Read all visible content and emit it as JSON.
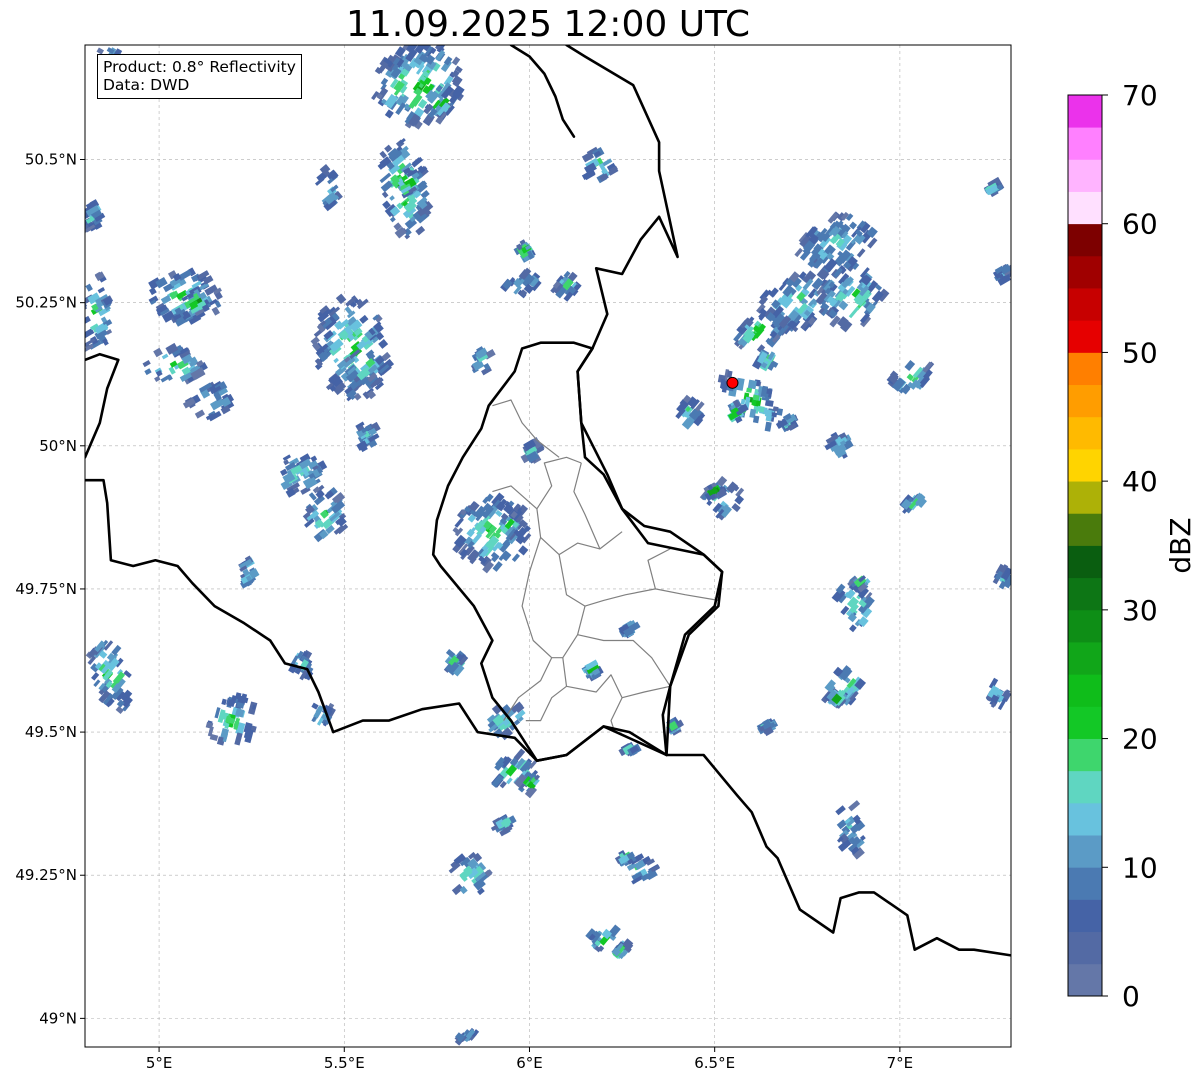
{
  "title": "11.09.2025 12:00 UTC",
  "info": {
    "product": "Product: 0.8° Reflectivity",
    "source": "Data: DWD"
  },
  "axes": {
    "lon_ticks": [
      "5°E",
      "5.5°E",
      "6°E",
      "6.5°E",
      "7°E"
    ],
    "lat_ticks": [
      "50.5°N",
      "50.25°N",
      "50°N",
      "49.75°N",
      "49.5°N",
      "49.25°N",
      "49°N"
    ],
    "lon_values": [
      5.0,
      5.5,
      6.0,
      6.5,
      7.0
    ],
    "lat_values": [
      50.5,
      50.25,
      50.0,
      49.75,
      49.5,
      49.25,
      49.0
    ],
    "lon_range": [
      4.8,
      7.3
    ],
    "lat_range": [
      48.95,
      50.7
    ],
    "grid": true
  },
  "colorbar": {
    "unit": "dBZ",
    "tick_labels": [
      "0",
      "10",
      "20",
      "30",
      "40",
      "50",
      "60",
      "70"
    ],
    "range": [
      0,
      70
    ],
    "step": 2.5,
    "colors": [
      "#6477a8",
      "#536aa4",
      "#4563a6",
      "#4b7ab2",
      "#5b9bc6",
      "#68c2de",
      "#5fd6c1",
      "#3ed66d",
      "#13c826",
      "#0fbd1a",
      "#11a619",
      "#0e8e16",
      "#0d7615",
      "#0a5e10",
      "#4a7b0c",
      "#adb107",
      "#ffd400",
      "#ffba00",
      "#ff9d00",
      "#ff7f00",
      "#e60000",
      "#c70000",
      "#a00000",
      "#7d0000",
      "#ffe0ff",
      "#ffb4ff",
      "#ff80ff",
      "#eb32eb"
    ]
  },
  "radar_site": {
    "lon": 6.548,
    "lat": 50.11,
    "color": "#ff0000"
  },
  "borders": {
    "country": [
      [
        [
          4.8,
          50.15
        ],
        [
          4.84,
          50.16
        ],
        [
          4.89,
          50.15
        ],
        [
          4.86,
          50.1
        ],
        [
          4.84,
          50.04
        ],
        [
          4.8,
          49.98
        ]
      ],
      [
        [
          4.8,
          49.94
        ],
        [
          4.85,
          49.94
        ],
        [
          4.86,
          49.9
        ],
        [
          4.87,
          49.8
        ],
        [
          4.93,
          49.79
        ],
        [
          4.99,
          49.8
        ],
        [
          5.05,
          49.79
        ],
        [
          5.09,
          49.76
        ],
        [
          5.15,
          49.72
        ],
        [
          5.23,
          49.69
        ],
        [
          5.3,
          49.66
        ],
        [
          5.34,
          49.62
        ],
        [
          5.4,
          49.61
        ],
        [
          5.43,
          49.57
        ],
        [
          5.47,
          49.5
        ],
        [
          5.55,
          49.52
        ],
        [
          5.62,
          49.52
        ],
        [
          5.71,
          49.54
        ],
        [
          5.81,
          49.55
        ],
        [
          5.86,
          49.5
        ],
        [
          5.96,
          49.49
        ],
        [
          6.02,
          49.45
        ],
        [
          6.1,
          49.46
        ],
        [
          6.2,
          49.51
        ],
        [
          6.27,
          49.5
        ],
        [
          6.37,
          49.46
        ],
        [
          6.47,
          49.46
        ],
        [
          6.56,
          49.39
        ],
        [
          6.6,
          49.36
        ],
        [
          6.64,
          49.3
        ],
        [
          6.67,
          49.28
        ],
        [
          6.73,
          49.19
        ],
        [
          6.82,
          49.15
        ],
        [
          6.84,
          49.21
        ],
        [
          6.89,
          49.22
        ],
        [
          6.93,
          49.22
        ],
        [
          7.02,
          49.18
        ],
        [
          7.04,
          49.12
        ],
        [
          7.1,
          49.14
        ],
        [
          7.16,
          49.12
        ],
        [
          7.2,
          49.12
        ],
        [
          7.3,
          49.11
        ]
      ],
      [
        [
          6.13,
          50.13
        ],
        [
          6.17,
          50.17
        ],
        [
          6.12,
          50.18
        ],
        [
          6.03,
          50.18
        ],
        [
          5.98,
          50.17
        ],
        [
          5.96,
          50.13
        ],
        [
          5.89,
          50.07
        ],
        [
          5.87,
          50.03
        ],
        [
          5.82,
          49.98
        ],
        [
          5.78,
          49.93
        ],
        [
          5.75,
          49.87
        ],
        [
          5.74,
          49.81
        ],
        [
          5.76,
          49.79
        ],
        [
          5.85,
          49.72
        ],
        [
          5.9,
          49.66
        ],
        [
          5.87,
          49.62
        ],
        [
          5.9,
          49.56
        ],
        [
          5.95,
          49.52
        ],
        [
          6.02,
          49.45
        ],
        [
          6.1,
          49.46
        ],
        [
          6.2,
          49.51
        ],
        [
          6.37,
          49.46
        ],
        [
          6.36,
          49.53
        ],
        [
          6.38,
          49.58
        ],
        [
          6.42,
          49.67
        ],
        [
          6.5,
          49.72
        ],
        [
          6.52,
          49.78
        ],
        [
          6.47,
          49.81
        ],
        [
          6.38,
          49.85
        ],
        [
          6.31,
          49.86
        ],
        [
          6.25,
          49.89
        ],
        [
          6.21,
          49.95
        ],
        [
          6.14,
          50.04
        ],
        [
          6.13,
          50.13
        ]
      ],
      [
        [
          6.17,
          50.17
        ],
        [
          6.13,
          50.13
        ],
        [
          6.14,
          50.04
        ],
        [
          6.15,
          49.98
        ],
        [
          6.2,
          49.95
        ],
        [
          6.25,
          49.89
        ],
        [
          6.32,
          49.83
        ],
        [
          6.47,
          49.81
        ],
        [
          6.52,
          49.78
        ],
        [
          6.51,
          49.72
        ],
        [
          6.43,
          49.67
        ],
        [
          6.38,
          49.58
        ],
        [
          6.37,
          49.46
        ]
      ],
      [
        [
          6.17,
          50.17
        ],
        [
          6.21,
          50.23
        ],
        [
          6.18,
          50.31
        ],
        [
          6.25,
          50.3
        ],
        [
          6.3,
          50.36
        ],
        [
          6.35,
          50.4
        ],
        [
          6.4,
          50.33
        ],
        [
          6.35,
          50.48
        ],
        [
          6.35,
          50.53
        ],
        [
          6.28,
          50.63
        ],
        [
          6.15,
          50.68
        ],
        [
          6.1,
          50.7
        ]
      ],
      [
        [
          5.95,
          50.7
        ],
        [
          6.0,
          50.68
        ],
        [
          6.04,
          50.65
        ],
        [
          6.07,
          50.61
        ],
        [
          6.09,
          50.57
        ],
        [
          6.12,
          50.54
        ]
      ]
    ],
    "cantons": [
      [
        [
          5.9,
          49.92
        ],
        [
          5.95,
          49.93
        ],
        [
          6.02,
          49.89
        ],
        [
          6.06,
          49.93
        ],
        [
          6.04,
          49.97
        ],
        [
          6.1,
          49.98
        ],
        [
          6.14,
          49.97
        ]
      ],
      [
        [
          6.02,
          49.89
        ],
        [
          6.03,
          49.84
        ],
        [
          6.08,
          49.81
        ],
        [
          6.13,
          49.83
        ],
        [
          6.19,
          49.82
        ],
        [
          6.25,
          49.85
        ]
      ],
      [
        [
          6.03,
          49.84
        ],
        [
          6.0,
          49.78
        ],
        [
          5.98,
          49.72
        ],
        [
          6.01,
          49.66
        ],
        [
          6.06,
          49.63
        ],
        [
          6.03,
          49.59
        ],
        [
          5.97,
          49.56
        ],
        [
          5.93,
          49.52
        ]
      ],
      [
        [
          6.08,
          49.81
        ],
        [
          6.1,
          49.74
        ],
        [
          6.15,
          49.72
        ],
        [
          6.2,
          49.73
        ],
        [
          6.26,
          49.74
        ],
        [
          6.34,
          49.75
        ],
        [
          6.42,
          49.74
        ],
        [
          6.51,
          49.73
        ]
      ],
      [
        [
          6.15,
          49.72
        ],
        [
          6.13,
          49.67
        ],
        [
          6.09,
          49.63
        ],
        [
          6.06,
          49.63
        ]
      ],
      [
        [
          6.13,
          49.67
        ],
        [
          6.2,
          49.66
        ],
        [
          6.28,
          49.66
        ],
        [
          6.33,
          49.63
        ],
        [
          6.38,
          49.58
        ]
      ],
      [
        [
          6.09,
          49.63
        ],
        [
          6.1,
          49.58
        ],
        [
          6.06,
          49.56
        ],
        [
          6.03,
          49.52
        ],
        [
          5.99,
          49.52
        ]
      ],
      [
        [
          6.1,
          49.58
        ],
        [
          6.18,
          49.57
        ],
        [
          6.22,
          49.6
        ],
        [
          6.25,
          49.56
        ],
        [
          6.22,
          49.52
        ],
        [
          6.23,
          49.5
        ]
      ],
      [
        [
          6.25,
          49.56
        ],
        [
          6.31,
          49.57
        ],
        [
          6.38,
          49.58
        ]
      ],
      [
        [
          6.34,
          49.75
        ],
        [
          6.32,
          49.8
        ],
        [
          6.38,
          49.82
        ]
      ],
      [
        [
          6.08,
          49.98
        ],
        [
          6.02,
          50.01
        ],
        [
          5.98,
          50.04
        ],
        [
          5.95,
          50.08
        ],
        [
          5.9,
          50.07
        ]
      ],
      [
        [
          6.14,
          49.97
        ],
        [
          6.12,
          49.92
        ],
        [
          6.15,
          49.88
        ],
        [
          6.19,
          49.82
        ]
      ]
    ]
  },
  "echo_regions": [
    {
      "lon": 4.87,
      "lat": 50.67,
      "w": 0.07,
      "h": 0.06,
      "a": -30,
      "lvl": 2
    },
    {
      "lon": 5.7,
      "lat": 50.63,
      "w": 0.25,
      "h": 0.14,
      "a": -25,
      "lvl": 4
    },
    {
      "lon": 5.76,
      "lat": 50.6,
      "w": 0.08,
      "h": 0.05,
      "a": -20,
      "lvl": 6
    },
    {
      "lon": 5.66,
      "lat": 50.45,
      "w": 0.12,
      "h": 0.18,
      "a": -10,
      "lvl": 4
    },
    {
      "lon": 5.67,
      "lat": 50.46,
      "w": 0.04,
      "h": 0.04,
      "a": 0,
      "lvl": 8
    },
    {
      "lon": 5.46,
      "lat": 50.45,
      "w": 0.05,
      "h": 0.07,
      "a": -10,
      "lvl": 1
    },
    {
      "lon": 4.82,
      "lat": 50.4,
      "w": 0.04,
      "h": 0.05,
      "a": 0,
      "lvl": 2
    },
    {
      "lon": 4.83,
      "lat": 50.23,
      "w": 0.08,
      "h": 0.14,
      "a": 0,
      "lvl": 2
    },
    {
      "lon": 5.07,
      "lat": 50.26,
      "w": 0.2,
      "h": 0.09,
      "a": 0,
      "lvl": 3
    },
    {
      "lon": 5.1,
      "lat": 50.25,
      "w": 0.06,
      "h": 0.04,
      "a": 0,
      "lvl": 6
    },
    {
      "lon": 5.04,
      "lat": 50.14,
      "w": 0.16,
      "h": 0.06,
      "a": 0,
      "lvl": 3
    },
    {
      "lon": 5.14,
      "lat": 50.08,
      "w": 0.12,
      "h": 0.06,
      "a": 0,
      "lvl": 1
    },
    {
      "lon": 5.52,
      "lat": 50.17,
      "w": 0.2,
      "h": 0.18,
      "a": -10,
      "lvl": 3
    },
    {
      "lon": 5.55,
      "lat": 50.14,
      "w": 0.1,
      "h": 0.05,
      "a": -10,
      "lvl": 6
    },
    {
      "lon": 5.56,
      "lat": 50.02,
      "w": 0.05,
      "h": 0.05,
      "a": 0,
      "lvl": 1
    },
    {
      "lon": 5.99,
      "lat": 50.34,
      "w": 0.04,
      "h": 0.03,
      "a": 0,
      "lvl": 3
    },
    {
      "lon": 5.98,
      "lat": 50.28,
      "w": 0.09,
      "h": 0.04,
      "a": -20,
      "lvl": 2
    },
    {
      "lon": 6.1,
      "lat": 50.28,
      "w": 0.06,
      "h": 0.04,
      "a": -20,
      "lvl": 2
    },
    {
      "lon": 6.19,
      "lat": 50.49,
      "w": 0.08,
      "h": 0.06,
      "a": 0,
      "lvl": 2
    },
    {
      "lon": 5.87,
      "lat": 50.15,
      "w": 0.05,
      "h": 0.05,
      "a": 0,
      "lvl": 1
    },
    {
      "lon": 5.38,
      "lat": 49.95,
      "w": 0.14,
      "h": 0.07,
      "a": 0,
      "lvl": 2
    },
    {
      "lon": 5.45,
      "lat": 49.88,
      "w": 0.1,
      "h": 0.1,
      "a": -10,
      "lvl": 4
    },
    {
      "lon": 5.24,
      "lat": 49.78,
      "w": 0.03,
      "h": 0.05,
      "a": 0,
      "lvl": 2
    },
    {
      "lon": 5.9,
      "lat": 49.85,
      "w": 0.2,
      "h": 0.13,
      "a": -20,
      "lvl": 3
    },
    {
      "lon": 5.95,
      "lat": 49.86,
      "w": 0.07,
      "h": 0.04,
      "a": -20,
      "lvl": 4
    },
    {
      "lon": 6.01,
      "lat": 49.99,
      "w": 0.04,
      "h": 0.03,
      "a": 0,
      "lvl": 2
    },
    {
      "lon": 4.87,
      "lat": 49.6,
      "w": 0.1,
      "h": 0.13,
      "a": -20,
      "lvl": 3
    },
    {
      "lon": 5.2,
      "lat": 49.52,
      "w": 0.14,
      "h": 0.08,
      "a": -45,
      "lvl": 3
    },
    {
      "lon": 5.38,
      "lat": 49.62,
      "w": 0.06,
      "h": 0.05,
      "a": -30,
      "lvl": 2
    },
    {
      "lon": 5.44,
      "lat": 49.53,
      "w": 0.05,
      "h": 0.04,
      "a": -30,
      "lvl": 2
    },
    {
      "lon": 5.8,
      "lat": 49.62,
      "w": 0.05,
      "h": 0.05,
      "a": -20,
      "lvl": 3
    },
    {
      "lon": 5.94,
      "lat": 49.52,
      "w": 0.12,
      "h": 0.05,
      "a": -10,
      "lvl": 3
    },
    {
      "lon": 5.96,
      "lat": 49.43,
      "w": 0.12,
      "h": 0.06,
      "a": -20,
      "lvl": 3
    },
    {
      "lon": 6.0,
      "lat": 49.41,
      "w": 0.06,
      "h": 0.03,
      "a": -20,
      "lvl": 6
    },
    {
      "lon": 5.93,
      "lat": 49.34,
      "w": 0.04,
      "h": 0.03,
      "a": 0,
      "lvl": 2
    },
    {
      "lon": 5.84,
      "lat": 49.25,
      "w": 0.1,
      "h": 0.07,
      "a": -10,
      "lvl": 3
    },
    {
      "lon": 6.17,
      "lat": 49.61,
      "w": 0.04,
      "h": 0.03,
      "a": 0,
      "lvl": 4
    },
    {
      "lon": 6.27,
      "lat": 49.68,
      "w": 0.03,
      "h": 0.02,
      "a": 0,
      "lvl": 2
    },
    {
      "lon": 6.3,
      "lat": 49.26,
      "w": 0.08,
      "h": 0.04,
      "a": 0,
      "lvl": 3
    },
    {
      "lon": 6.26,
      "lat": 49.28,
      "w": 0.04,
      "h": 0.02,
      "a": 0,
      "lvl": 5
    },
    {
      "lon": 6.2,
      "lat": 49.14,
      "w": 0.09,
      "h": 0.04,
      "a": -20,
      "lvl": 3
    },
    {
      "lon": 6.25,
      "lat": 49.12,
      "w": 0.04,
      "h": 0.02,
      "a": -20,
      "lvl": 6
    },
    {
      "lon": 5.83,
      "lat": 48.97,
      "w": 0.05,
      "h": 0.01,
      "a": -20,
      "lvl": 2
    },
    {
      "lon": 6.39,
      "lat": 49.51,
      "w": 0.02,
      "h": 0.02,
      "a": 0,
      "lvl": 3
    },
    {
      "lon": 6.27,
      "lat": 49.47,
      "w": 0.03,
      "h": 0.01,
      "a": 0,
      "lvl": 2
    },
    {
      "lon": 6.83,
      "lat": 50.35,
      "w": 0.22,
      "h": 0.1,
      "a": -20,
      "lvl": 1
    },
    {
      "lon": 6.72,
      "lat": 50.25,
      "w": 0.2,
      "h": 0.09,
      "a": -20,
      "lvl": 2
    },
    {
      "lon": 6.87,
      "lat": 50.26,
      "w": 0.18,
      "h": 0.1,
      "a": -20,
      "lvl": 3
    },
    {
      "lon": 6.62,
      "lat": 50.2,
      "w": 0.15,
      "h": 0.06,
      "a": -20,
      "lvl": 3
    },
    {
      "lon": 6.6,
      "lat": 50.08,
      "w": 0.1,
      "h": 0.13,
      "a": -50,
      "lvl": 4
    },
    {
      "lon": 6.56,
      "lat": 50.06,
      "w": 0.03,
      "h": 0.03,
      "a": 0,
      "lvl": 7
    },
    {
      "lon": 6.64,
      "lat": 50.15,
      "w": 0.05,
      "h": 0.03,
      "a": -30,
      "lvl": 6
    },
    {
      "lon": 6.43,
      "lat": 50.06,
      "w": 0.07,
      "h": 0.05,
      "a": -20,
      "lvl": 2
    },
    {
      "lon": 6.52,
      "lat": 49.91,
      "w": 0.1,
      "h": 0.06,
      "a": -20,
      "lvl": 3
    },
    {
      "lon": 6.5,
      "lat": 49.92,
      "w": 0.04,
      "h": 0.02,
      "a": 0,
      "lvl": 7
    },
    {
      "lon": 6.84,
      "lat": 50.0,
      "w": 0.06,
      "h": 0.04,
      "a": 0,
      "lvl": 2
    },
    {
      "lon": 6.7,
      "lat": 50.04,
      "w": 0.04,
      "h": 0.02,
      "a": 0,
      "lvl": 2
    },
    {
      "lon": 7.03,
      "lat": 50.12,
      "w": 0.12,
      "h": 0.05,
      "a": -20,
      "lvl": 3
    },
    {
      "lon": 7.04,
      "lat": 49.9,
      "w": 0.06,
      "h": 0.02,
      "a": -20,
      "lvl": 4
    },
    {
      "lon": 6.88,
      "lat": 49.72,
      "w": 0.08,
      "h": 0.1,
      "a": -20,
      "lvl": 3
    },
    {
      "lon": 6.89,
      "lat": 49.76,
      "w": 0.04,
      "h": 0.02,
      "a": -10,
      "lvl": 7
    },
    {
      "lon": 6.85,
      "lat": 49.58,
      "w": 0.12,
      "h": 0.06,
      "a": -20,
      "lvl": 3
    },
    {
      "lon": 6.83,
      "lat": 49.56,
      "w": 0.05,
      "h": 0.02,
      "a": -20,
      "lvl": 5
    },
    {
      "lon": 6.87,
      "lat": 49.33,
      "w": 0.08,
      "h": 0.09,
      "a": -10,
      "lvl": 1
    },
    {
      "lon": 7.26,
      "lat": 49.57,
      "w": 0.05,
      "h": 0.05,
      "a": -30,
      "lvl": 1
    },
    {
      "lon": 7.28,
      "lat": 49.77,
      "w": 0.04,
      "h": 0.03,
      "a": -30,
      "lvl": 1
    },
    {
      "lon": 7.28,
      "lat": 50.3,
      "w": 0.03,
      "h": 0.03,
      "a": 0,
      "lvl": 1
    },
    {
      "lon": 7.25,
      "lat": 50.45,
      "w": 0.03,
      "h": 0.02,
      "a": 0,
      "lvl": 1
    },
    {
      "lon": 6.64,
      "lat": 49.51,
      "w": 0.03,
      "h": 0.02,
      "a": 0,
      "lvl": 3
    }
  ]
}
